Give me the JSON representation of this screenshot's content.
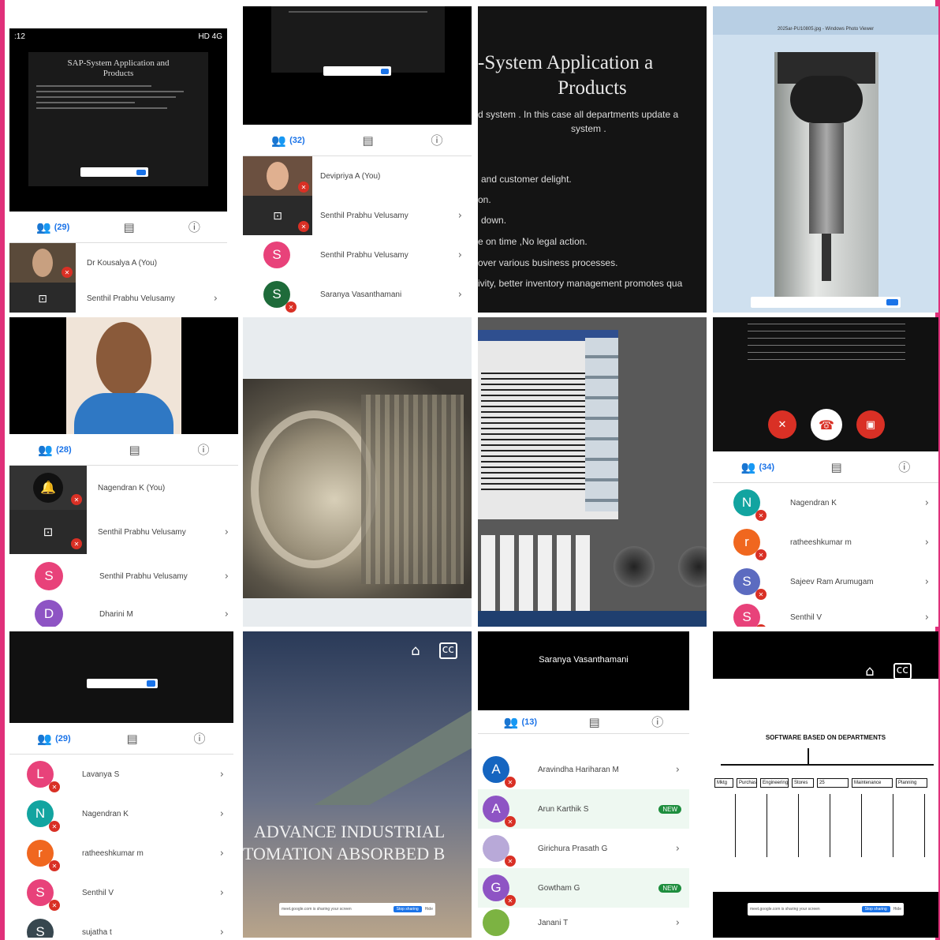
{
  "tiles": {
    "t1": {
      "status_time": ":12",
      "status_right": "HD 4G",
      "slide_title": "SAP-System Application and Products",
      "people_count": "(29)",
      "participants": [
        {
          "name": "Dr Kousalya A (You)"
        },
        {
          "name": "Senthil Prabhu Velusamy"
        }
      ]
    },
    "t2": {
      "people_count": "(32)",
      "participants": [
        {
          "name": "Devipriya A (You)"
        },
        {
          "name": "Senthil Prabhu Velusamy"
        },
        {
          "name": "Senthil Prabhu Velusamy",
          "initial": "S"
        },
        {
          "name": "Saranya Vasanthamani",
          "initial": "S"
        }
      ]
    },
    "t3": {
      "title_line1": "-System Application a",
      "title_line2": "Products",
      "lines": [
        "d system . In this case all departments update a",
        "system .",
        "and customer delight.",
        "on.",
        "down.",
        "e on time ,No legal action.",
        "over various business processes.",
        "ivity, better inventory management promotes qua"
      ]
    },
    "t4": {
      "window_title": "2025ar-PU10805.jpg - Windows Photo Viewer"
    },
    "t5": {
      "people_count": "(28)",
      "participants": [
        {
          "name": "Nagendran K (You)"
        },
        {
          "name": "Senthil Prabhu Velusamy"
        },
        {
          "name": "Senthil Prabhu Velusamy",
          "initial": "S"
        },
        {
          "name": "Dharini M",
          "initial": "D"
        }
      ]
    },
    "t8": {
      "people_count": "(34)",
      "participants": [
        {
          "name": "Nagendran K",
          "initial": "N"
        },
        {
          "name": "ratheeshkumar m",
          "initial": "r"
        },
        {
          "name": "Sajeev Ram Arumugam",
          "initial": "S"
        },
        {
          "name": "Senthil V",
          "initial": "S"
        }
      ]
    },
    "t9": {
      "people_count": "(29)",
      "participants": [
        {
          "name": "Lavanya S",
          "initial": "L"
        },
        {
          "name": "Nagendran K",
          "initial": "N"
        },
        {
          "name": "ratheeshkumar m",
          "initial": "r"
        },
        {
          "name": "Senthil V",
          "initial": "S"
        },
        {
          "name": "sujatha t",
          "initial": "S"
        }
      ]
    },
    "t10": {
      "overlay_line1": "ADVANCE INDUSTRIAL",
      "overlay_line2": "TOMATION ABSORBED B",
      "share_text": "meet.google.com is sharing your screen",
      "stop_label": "Stop sharing",
      "hide_label": "Hide"
    },
    "t11": {
      "speaker": "Saranya Vasanthamani",
      "people_count": "(13)",
      "participants": [
        {
          "name": "Aravindha Hariharan M",
          "initial": "A"
        },
        {
          "name": "Arun Karthik S",
          "initial": "A",
          "badge": "NEW"
        },
        {
          "name": "Girichura Prasath G",
          "initial": ""
        },
        {
          "name": "Gowtham G",
          "initial": "G",
          "badge": "NEW"
        },
        {
          "name": "Janani T",
          "initial": ""
        }
      ]
    },
    "t12": {
      "diagram_title": "SOFTWARE BASED ON DEPARTMENTS",
      "columns": [
        "Mktg",
        "Purchase",
        "Engineering",
        "Stores",
        "25",
        "Maintenance",
        "Planning"
      ],
      "share_text": "meet.google.com is sharing your screen",
      "stop_label": "Stop sharing",
      "hide_label": "Hide"
    }
  },
  "colors": {
    "frame": "#e0307a",
    "accent": "#1a73e8",
    "mute": "#d93025",
    "new_badge": "#1e8e3e",
    "avatar_pink": "#e8427a",
    "avatar_teal": "#12a4a0",
    "avatar_orange": "#f0671f",
    "avatar_indigo": "#5c6bc0",
    "avatar_green": "#1e6b3a",
    "avatar_blue": "#1565c0",
    "avatar_purple": "#8e54c4"
  }
}
